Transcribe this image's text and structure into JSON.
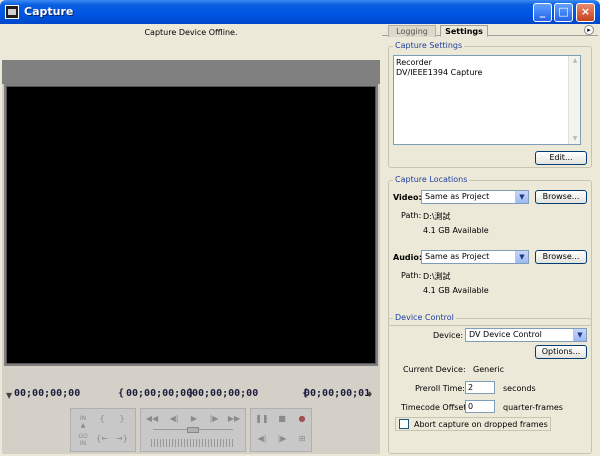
{
  "window": {
    "title": "Capture",
    "minimize": "_",
    "maximize": "□",
    "close": "×"
  },
  "monitor": {
    "status": "Capture Device Offline.",
    "timecode_current": "00;00;00;00",
    "timecode_in": "00;00;00;00",
    "timecode_out": "00;00;00;00",
    "timecode_duration": "00;00;00;01"
  },
  "tabs": {
    "logging": "Logging",
    "settings": "Settings",
    "menu_glyph": "▸"
  },
  "capture_settings": {
    "title": "Capture Settings",
    "line1": "Recorder",
    "line2": "DV/IEEE1394 Capture",
    "edit_button": "Edit..."
  },
  "capture_locations": {
    "title": "Capture Locations",
    "video_label": "Video:",
    "video_value": "Same as Project",
    "video_browse": "Browse...",
    "video_path_label": "Path:",
    "video_path": "D:\\測試",
    "video_available": "4.1 GB Available",
    "audio_label": "Audio:",
    "audio_value": "Same as Project",
    "audio_browse": "Browse...",
    "audio_path_label": "Path:",
    "audio_path": "D:\\測試",
    "audio_available": "4.1 GB Available"
  },
  "device_control": {
    "title": "Device Control",
    "device_label": "Device:",
    "device_value": "DV Device Control",
    "options_button": "Options...",
    "current_device_label": "Current Device:",
    "current_device_value": "Generic",
    "preroll_label": "Preroll Time:",
    "preroll_value": "2",
    "preroll_unit": "seconds",
    "offset_label": "Timecode Offset:",
    "offset_value": "0",
    "offset_unit": "quarter-frames",
    "abort_label": "Abort capture on dropped frames",
    "abort_checked": false
  },
  "colors": {
    "accent": "#1f3fa0",
    "titlebar": "#0054e3"
  }
}
